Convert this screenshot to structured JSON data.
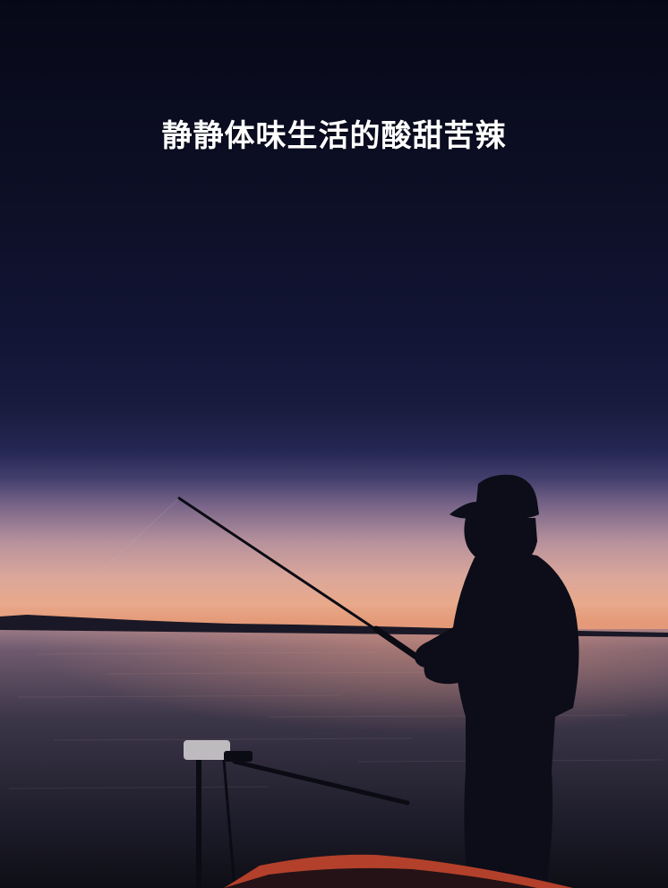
{
  "headline": "静静体味生活的酸甜苦辣",
  "palette": {
    "sky_top": "#070817",
    "sky_mid": "#191b3f",
    "horizon_glow": "#e8a98b",
    "water": "#2a2a3c",
    "silhouette": "#0c0d18",
    "boat_red": "#b3402a"
  },
  "scene": {
    "subject": "silhouette-fisherman",
    "setting": "lake-sunset"
  }
}
